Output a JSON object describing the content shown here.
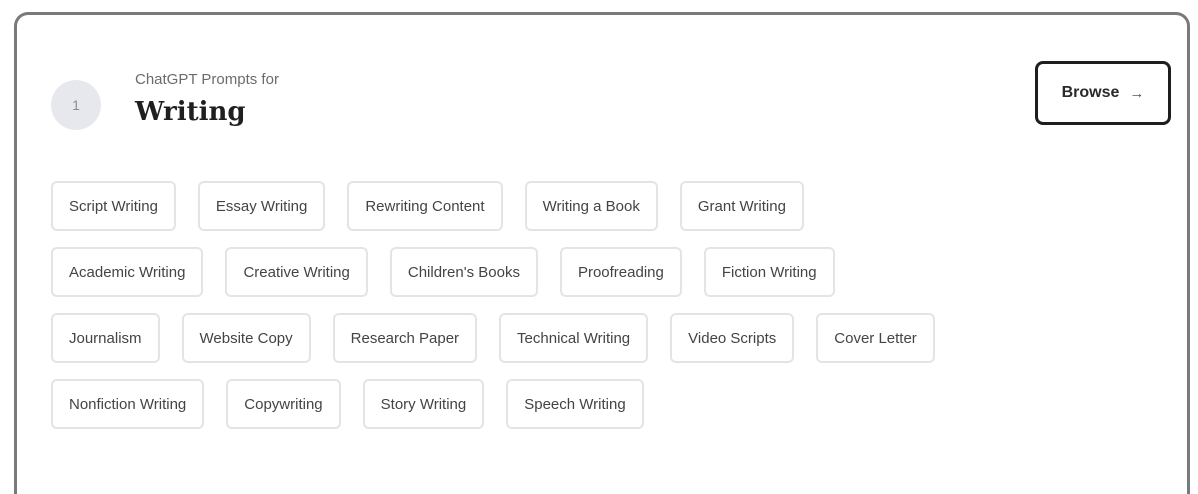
{
  "card": {
    "badge_text": "1",
    "subtitle": "ChatGPT Prompts for",
    "title": "Writing",
    "browse_label": "Browse",
    "browse_icon": "→"
  },
  "chips": {
    "row1": [
      "Script Writing",
      "Essay Writing",
      "Rewriting Content",
      "Writing a Book",
      "Grant Writing"
    ],
    "row2": [
      "Academic Writing",
      "Creative Writing",
      "Children's Books",
      "Proofreading",
      "Fiction Writing"
    ],
    "row3": [
      "Journalism",
      "Website Copy",
      "Research Paper",
      "Technical Writing",
      "Video Scripts",
      "Cover Letter"
    ],
    "row4": [
      "Nonfiction Writing",
      "Copywriting",
      "Story Writing",
      "Speech Writing"
    ]
  }
}
